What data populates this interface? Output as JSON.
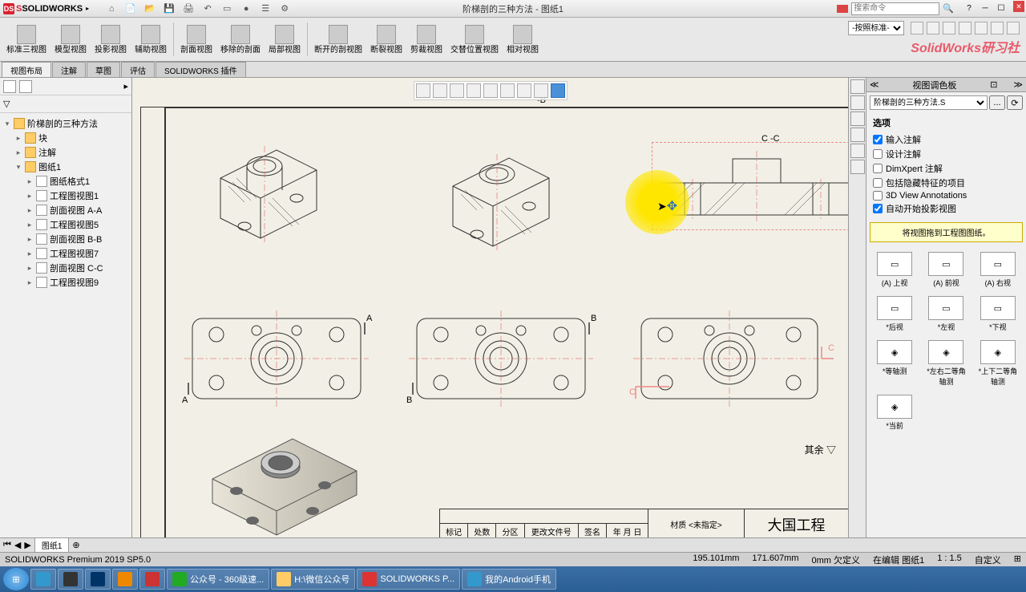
{
  "app": {
    "name": "SOLIDWORKS",
    "doc_title": "阶梯剖的三种方法 - 图纸1"
  },
  "qat": [
    "home",
    "new",
    "open",
    "save",
    "print",
    "undo",
    "redo",
    "select",
    "rebuild",
    "options",
    "settings"
  ],
  "search": {
    "placeholder": "搜索命令"
  },
  "ribbon": [
    {
      "label": "标准三视图"
    },
    {
      "label": "模型视图"
    },
    {
      "label": "投影视图"
    },
    {
      "label": "辅助视图"
    },
    {
      "label": "剖面视图"
    },
    {
      "label": "移除的剖面"
    },
    {
      "label": "局部视图"
    },
    {
      "label": "断开的剖视图"
    },
    {
      "label": "断裂视图"
    },
    {
      "label": "剪裁视图"
    },
    {
      "label": "交替位置视图"
    },
    {
      "label": "相对视图"
    }
  ],
  "format_std": "-按照标准-",
  "watermark": "SolidWorks研习社",
  "tabs": [
    "视图布局",
    "注解",
    "草图",
    "评估",
    "SOLIDWORKS 插件"
  ],
  "active_tab": 0,
  "tree": {
    "root": "阶梯剖的三种方法",
    "items": [
      {
        "label": "块",
        "indent": 1,
        "type": "folder"
      },
      {
        "label": "注解",
        "indent": 1,
        "type": "folder"
      },
      {
        "label": "图纸1",
        "indent": 1,
        "type": "folder",
        "expanded": true
      },
      {
        "label": "图纸格式1",
        "indent": 2,
        "type": "doc"
      },
      {
        "label": "工程图视图1",
        "indent": 2,
        "type": "doc"
      },
      {
        "label": "剖面视图 A-A",
        "indent": 2,
        "type": "doc"
      },
      {
        "label": "工程图视图5",
        "indent": 2,
        "type": "doc"
      },
      {
        "label": "剖面视图 B-B",
        "indent": 2,
        "type": "doc"
      },
      {
        "label": "工程图视图7",
        "indent": 2,
        "type": "doc"
      },
      {
        "label": "剖面视图 C-C",
        "indent": 2,
        "type": "doc"
      },
      {
        "label": "工程图视图9",
        "indent": 2,
        "type": "doc"
      }
    ]
  },
  "section_label_b": "-B",
  "section_label_c": "C -C",
  "section_marks": {
    "a": "A",
    "b": "B",
    "c": "C"
  },
  "task_pane": {
    "title": "视图调色板",
    "dropdown": "阶梯剖的三种方法.S",
    "section_options": "选项",
    "checks": [
      {
        "label": "输入注解",
        "checked": true
      },
      {
        "label": "设计注解",
        "checked": false
      },
      {
        "label": "DimXpert 注解",
        "checked": false
      },
      {
        "label": "包括隐藏特征的项目",
        "checked": false
      },
      {
        "label": "3D View Annotations",
        "checked": false
      },
      {
        "label": "自动开始投影视图",
        "checked": true
      }
    ],
    "hint": "将视图拖到工程图图纸。",
    "views": [
      {
        "label": "(A) 上视"
      },
      {
        "label": "(A) 前视"
      },
      {
        "label": "(A) 右视"
      },
      {
        "label": "*后视"
      },
      {
        "label": "*左视"
      },
      {
        "label": "*下视"
      },
      {
        "label": "*等轴测"
      },
      {
        "label": "*左右二等角轴测"
      },
      {
        "label": "*上下二等角轴测"
      },
      {
        "label": "*当前"
      }
    ],
    "more": "其余 ▽"
  },
  "title_block": {
    "material_label": "材质 <未指定>",
    "company": "大国工程",
    "headers": [
      "标记",
      "处数",
      "分区",
      "更改文件号",
      "签名",
      "年 月 日"
    ]
  },
  "sheet_tab": "图纸1",
  "status": {
    "left": "SOLIDWORKS Premium 2019 SP5.0",
    "coords_x": "195.101mm",
    "coords_y": "171.607mm",
    "z": "0mm 欠定义",
    "edit": "在编辑 图纸1",
    "scale": "1 : 1.5",
    "custom": "自定义"
  },
  "taskbar": [
    {
      "label": ""
    },
    {
      "label": ""
    },
    {
      "label": ""
    },
    {
      "label": ""
    },
    {
      "label": ""
    },
    {
      "label": ""
    },
    {
      "label": "公众号 - 360级速..."
    },
    {
      "label": "H:\\微信公众号"
    },
    {
      "label": "SOLIDWORKS P..."
    },
    {
      "label": "我的Android手机"
    }
  ]
}
